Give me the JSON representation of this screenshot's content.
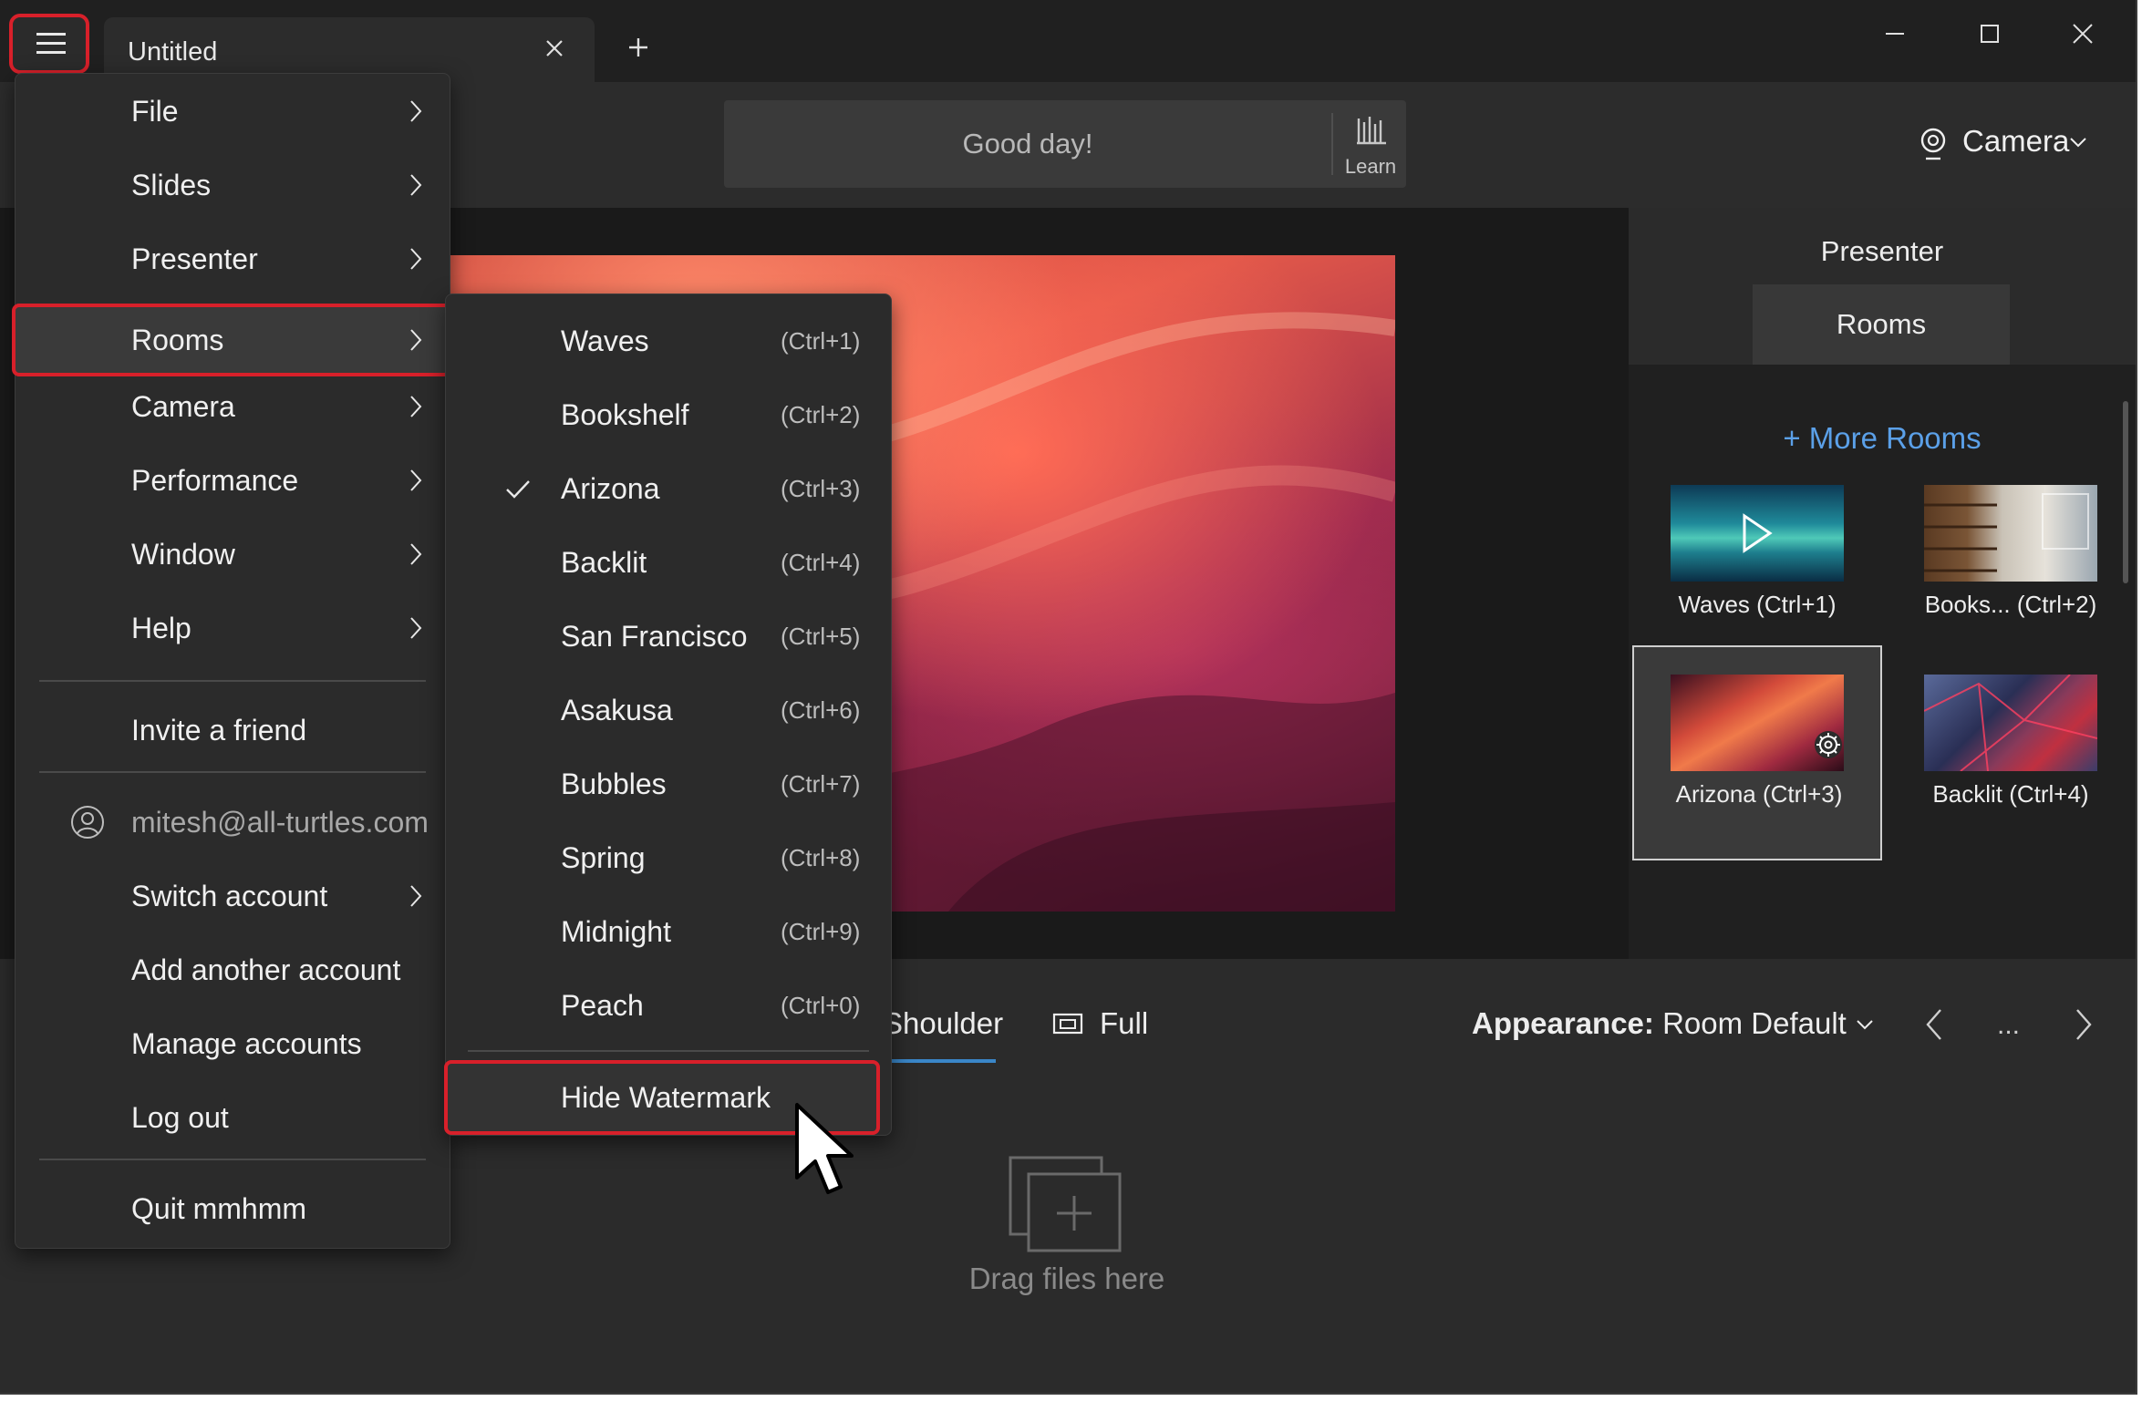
{
  "titlebar": {
    "tab_title": "Untitled",
    "tab_close_icon": "close-icon",
    "new_tab_icon": "plus-icon",
    "window_controls": [
      "minimize-icon",
      "maximize-icon",
      "close-icon"
    ]
  },
  "toolbar": {
    "greeting": "Good day!",
    "learn_label": "Learn",
    "camera_label": "Camera"
  },
  "main_menu": {
    "items": [
      {
        "label": "File",
        "submenu": true
      },
      {
        "label": "Slides",
        "submenu": true
      },
      {
        "label": "Presenter",
        "submenu": true
      },
      {
        "label": "Rooms",
        "submenu": true,
        "highlighted": true
      },
      {
        "label": "Camera",
        "submenu": true
      },
      {
        "label": "Performance",
        "submenu": true
      },
      {
        "label": "Window",
        "submenu": true
      },
      {
        "label": "Help",
        "submenu": true
      }
    ],
    "invite": "Invite a friend",
    "account_email": "mitesh@all-turtles.com",
    "account_items": [
      {
        "label": "Switch account",
        "submenu": true
      },
      {
        "label": "Add another account",
        "submenu": false
      },
      {
        "label": "Manage accounts",
        "submenu": false
      },
      {
        "label": "Log out",
        "submenu": false
      }
    ],
    "quit": "Quit mmhmm"
  },
  "rooms_submenu": {
    "items": [
      {
        "label": "Waves",
        "shortcut": "(Ctrl+1)",
        "checked": false
      },
      {
        "label": "Bookshelf",
        "shortcut": "(Ctrl+2)",
        "checked": false
      },
      {
        "label": "Arizona",
        "shortcut": "(Ctrl+3)",
        "checked": true
      },
      {
        "label": "Backlit",
        "shortcut": "(Ctrl+4)",
        "checked": false
      },
      {
        "label": "San Francisco",
        "shortcut": "(Ctrl+5)",
        "checked": false
      },
      {
        "label": "Asakusa",
        "shortcut": "(Ctrl+6)",
        "checked": false
      },
      {
        "label": "Bubbles",
        "shortcut": "(Ctrl+7)",
        "checked": false
      },
      {
        "label": "Spring",
        "shortcut": "(Ctrl+8)",
        "checked": false
      },
      {
        "label": "Midnight",
        "shortcut": "(Ctrl+9)",
        "checked": false
      },
      {
        "label": "Peach",
        "shortcut": "(Ctrl+0)",
        "checked": false
      }
    ],
    "hide_watermark": "Hide Watermark"
  },
  "panel": {
    "title": "Presenter",
    "active_tab": "Rooms",
    "more_rooms": "+ More Rooms",
    "rooms": [
      {
        "label": "Waves (Ctrl+1)",
        "selected": false
      },
      {
        "label": "Books... (Ctrl+2)",
        "selected": false
      },
      {
        "label": "Arizona (Ctrl+3)",
        "selected": true
      },
      {
        "label": "Backlit (Ctrl+4)",
        "selected": false
      }
    ]
  },
  "bottom": {
    "tab_shoulder": "Shoulder",
    "tab_full": "Full",
    "appearance_label": "Appearance:",
    "appearance_value": "Room Default",
    "more": "...",
    "drop_text": "Drag files here"
  },
  "colors": {
    "accent_red": "#d8202a",
    "link_blue": "#5ba0e8",
    "tab_underline": "#3a86c8"
  }
}
